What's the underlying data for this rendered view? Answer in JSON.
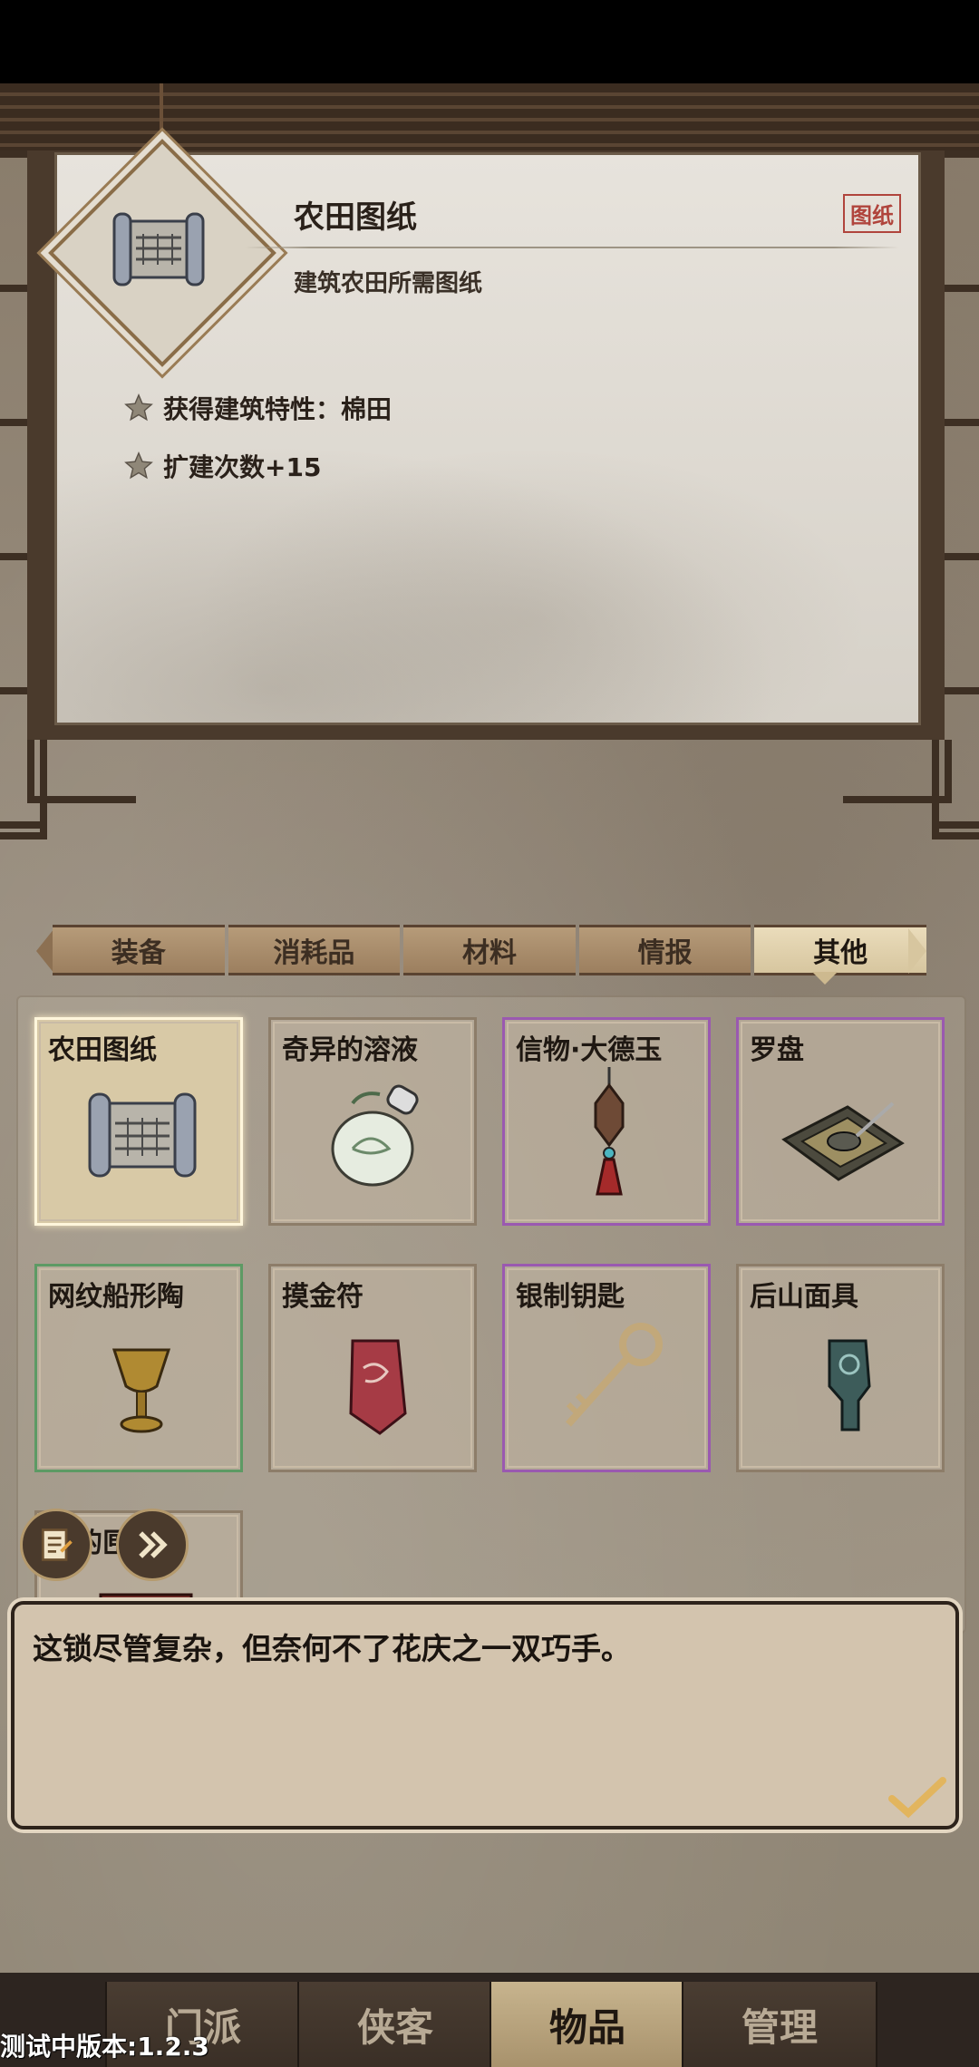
{
  "detail": {
    "title": "农田图纸",
    "tag": "图纸",
    "subtitle": "建筑农田所需图纸",
    "attributes": [
      "获得建筑特性：棉田",
      "扩建次数+15"
    ]
  },
  "tabs": [
    {
      "label": "装备",
      "active": false
    },
    {
      "label": "消耗品",
      "active": false
    },
    {
      "label": "材料",
      "active": false
    },
    {
      "label": "情报",
      "active": false
    },
    {
      "label": "其他",
      "active": true
    }
  ],
  "items": [
    {
      "name": "农田图纸",
      "rarity": "selected",
      "icon": "scroll-icon"
    },
    {
      "name": "奇异的溶液",
      "rarity": "normal",
      "icon": "bottle-icon"
    },
    {
      "name": "信物·大德玉",
      "rarity": "purple",
      "icon": "jade-pendant-icon"
    },
    {
      "name": "罗盘",
      "rarity": "purple",
      "icon": "compass-icon"
    },
    {
      "name": "网纹船形陶",
      "rarity": "green",
      "icon": "goblet-icon"
    },
    {
      "name": "摸金符",
      "rarity": "normal",
      "icon": "talisman-icon"
    },
    {
      "name": "银制钥匙",
      "rarity": "purple",
      "icon": "key-icon"
    },
    {
      "name": "后山面具",
      "rarity": "normal",
      "icon": "mask-icon"
    },
    {
      "name": "重的匣子",
      "rarity": "normal",
      "icon": "box-icon"
    }
  ],
  "dialog": {
    "text": "这锁尽管复杂，但奈何不了花庆之一双巧手。"
  },
  "nav": [
    {
      "label": "门派",
      "active": false
    },
    {
      "label": "侠客",
      "active": false
    },
    {
      "label": "物品",
      "active": true
    },
    {
      "label": "管理",
      "active": false
    }
  ],
  "version": "测试中版本:1.2.3",
  "colors": {
    "rarity_purple": "#9a59b0",
    "rarity_green": "#5d9a64",
    "tag_red": "#b0443c",
    "active_tab": "#d7c69f"
  }
}
